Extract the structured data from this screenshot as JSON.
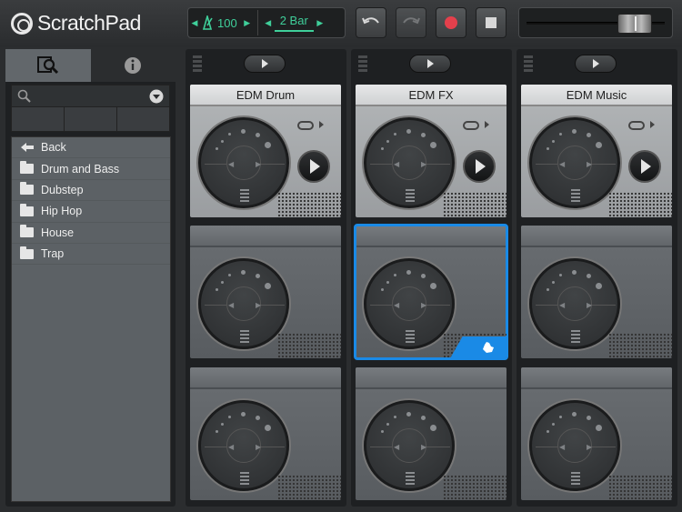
{
  "app": {
    "name": "ScratchPad"
  },
  "transport": {
    "tempo": "100",
    "bar_length": "2 Bar",
    "undo_label": "undo",
    "redo_label": "redo"
  },
  "browser": {
    "tabs": [
      "search",
      "info"
    ],
    "search_placeholder": "",
    "items": [
      {
        "label": "Back",
        "icon": "back-arrow-icon"
      },
      {
        "label": "Drum and Bass",
        "icon": "folder-icon"
      },
      {
        "label": "Dubstep",
        "icon": "folder-icon"
      },
      {
        "label": "Hip Hop",
        "icon": "folder-icon"
      },
      {
        "label": "House",
        "icon": "folder-icon"
      },
      {
        "label": "Trap",
        "icon": "folder-icon"
      }
    ]
  },
  "columns": [
    {
      "title": "EDM Drum"
    },
    {
      "title": "EDM FX"
    },
    {
      "title": "EDM Music"
    }
  ],
  "colors": {
    "accent_green": "#3fcf9a",
    "selection_blue": "#1a8ae6",
    "record_red": "#e4404c"
  }
}
